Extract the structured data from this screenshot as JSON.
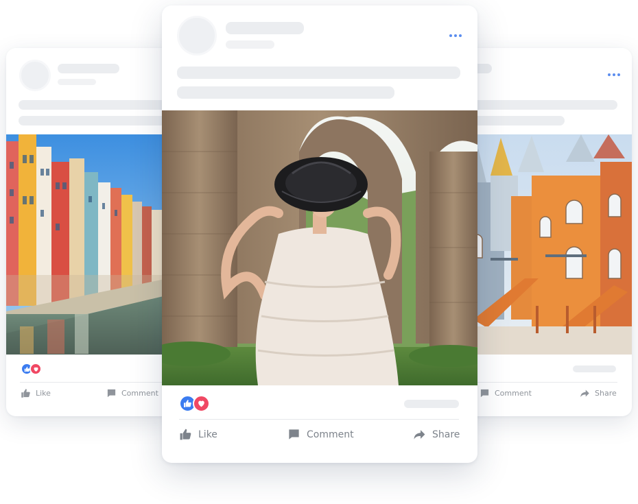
{
  "posts": {
    "left": {
      "photo": "canal-houses-photo",
      "reactions": [
        "like",
        "love"
      ],
      "actions": {
        "like": "Like",
        "comment": "Comment"
      }
    },
    "center": {
      "photo": "woman-in-hat-photo",
      "reactions": [
        "like",
        "love"
      ],
      "actions": {
        "like": "Like",
        "comment": "Comment",
        "share": "Share"
      }
    },
    "right": {
      "photo": "orange-castle-photo",
      "actions": {
        "comment": "Comment",
        "share": "Share"
      }
    }
  },
  "colors": {
    "accent": "#5b8def",
    "like_badge": "#3b7cf0",
    "love_badge": "#f04863",
    "skeleton": "#ebedf0",
    "action_text": "#8f949b"
  },
  "icons": [
    "more-options-icon",
    "thumbs-up-icon",
    "heart-icon",
    "comment-icon",
    "share-arrow-icon"
  ]
}
